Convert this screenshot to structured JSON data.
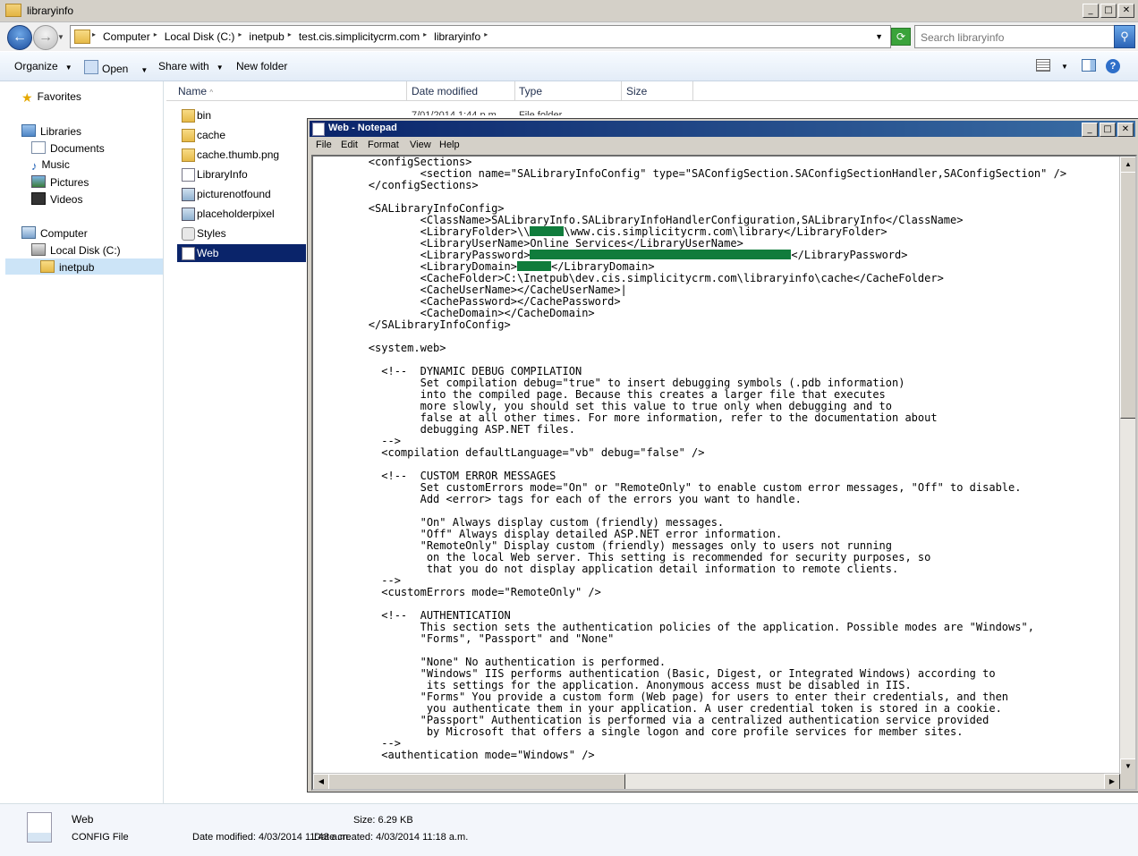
{
  "explorer": {
    "title": "libraryinfo",
    "breadcrumb": [
      "Computer",
      "Local Disk (C:)",
      "inetpub",
      "test.cis.simplicitycrm.com",
      "libraryinfo"
    ],
    "search_placeholder": "Search libraryinfo",
    "toolbar": {
      "organize": "Organize",
      "open": "Open",
      "share": "Share with",
      "new_folder": "New folder"
    },
    "nav": {
      "favorites": "Favorites",
      "libraries": "Libraries",
      "documents": "Documents",
      "music": "Music",
      "pictures": "Pictures",
      "videos": "Videos",
      "computer": "Computer",
      "local_disk": "Local Disk (C:)",
      "inetpub": "inetpub"
    },
    "columns": {
      "name": "Name",
      "date_modified": "Date modified",
      "type": "Type",
      "size": "Size"
    },
    "files": [
      "bin",
      "cache",
      "cache.thumb.png",
      "LibraryInfo",
      "picturenotfound",
      "placeholderpixel",
      "Styles",
      "Web"
    ],
    "first_row_date": "7/01/2014 1:44 p.m.",
    "first_row_type": "File folder",
    "details": {
      "name": "Web",
      "type": "CONFIG File",
      "date_modified": "Date modified: 4/03/2014 11:43 a.m.",
      "size": "Size: 6.29 KB",
      "date_created": "Date created: 4/03/2014 11:18 a.m."
    }
  },
  "notepad": {
    "title": "Web - Notepad",
    "menu": {
      "file": "File",
      "edit": "Edit",
      "format": "Format",
      "view": "View",
      "help": "Help"
    },
    "lines": {
      "l1": "        <configSections>",
      "l2": "                <section name=\"SALibraryInfoConfig\" type=\"SAConfigSection.SAConfigSectionHandler,SAConfigSection\" />",
      "l3": "        </configSections>",
      "l4": "",
      "l5": "        <SALibraryInfoConfig>",
      "l6": "                <ClassName>SALibraryInfo.SALibraryInfoHandlerConfiguration,SALibraryInfo</ClassName>",
      "l7a": "                <LibraryFolder>\\\\",
      "l7b": "\\www.cis.simplicitycrm.com\\library</LibraryFolder>",
      "l8": "                <LibraryUserName>Online Services</LibraryUserName>",
      "l9a": "                <LibraryPassword>",
      "l9b": "</LibraryPassword>",
      "l10a": "                <LibraryDomain>",
      "l10b": "</LibraryDomain>",
      "l11": "                <CacheFolder>C:\\Inetpub\\dev.cis.simplicitycrm.com\\libraryinfo\\cache</CacheFolder>",
      "l12": "                <CacheUserName></CacheUserName>|",
      "l13": "                <CachePassword></CachePassword>",
      "l14": "                <CacheDomain></CacheDomain>",
      "l15": "        </SALibraryInfoConfig>",
      "l16": "",
      "l17": "        <system.web>",
      "l18": "",
      "l19": "          <!--  DYNAMIC DEBUG COMPILATION",
      "l20": "                Set compilation debug=\"true\" to insert debugging symbols (.pdb information)",
      "l21": "                into the compiled page. Because this creates a larger file that executes",
      "l22": "                more slowly, you should set this value to true only when debugging and to",
      "l23": "                false at all other times. For more information, refer to the documentation about",
      "l24": "                debugging ASP.NET files.",
      "l25": "          -->",
      "l26": "          <compilation defaultLanguage=\"vb\" debug=\"false\" />",
      "l27": "",
      "l28": "          <!--  CUSTOM ERROR MESSAGES",
      "l29": "                Set customErrors mode=\"On\" or \"RemoteOnly\" to enable custom error messages, \"Off\" to disable.",
      "l30": "                Add <error> tags for each of the errors you want to handle.",
      "l31": "",
      "l32": "                \"On\" Always display custom (friendly) messages.",
      "l33": "                \"Off\" Always display detailed ASP.NET error information.",
      "l34": "                \"RemoteOnly\" Display custom (friendly) messages only to users not running",
      "l35": "                 on the local Web server. This setting is recommended for security purposes, so",
      "l36": "                 that you do not display application detail information to remote clients.",
      "l37": "          -->",
      "l38": "          <customErrors mode=\"RemoteOnly\" />",
      "l39": "",
      "l40": "          <!--  AUTHENTICATION",
      "l41": "                This section sets the authentication policies of the application. Possible modes are \"Windows\",",
      "l42": "                \"Forms\", \"Passport\" and \"None\"",
      "l43": "",
      "l44": "                \"None\" No authentication is performed.",
      "l45": "                \"Windows\" IIS performs authentication (Basic, Digest, or Integrated Windows) according to",
      "l46": "                 its settings for the application. Anonymous access must be disabled in IIS.",
      "l47": "                \"Forms\" You provide a custom form (Web page) for users to enter their credentials, and then",
      "l48": "                 you authenticate them in your application. A user credential token is stored in a cookie.",
      "l49": "                \"Passport\" Authentication is performed via a centralized authentication service provided",
      "l50": "                 by Microsoft that offers a single logon and core profile services for member sites.",
      "l51": "          -->",
      "l52": "          <authentication mode=\"Windows\" />"
    }
  },
  "colors": {
    "selection": "#0a246a",
    "redaction": "#107c3c",
    "title_active": "#0a246a"
  }
}
